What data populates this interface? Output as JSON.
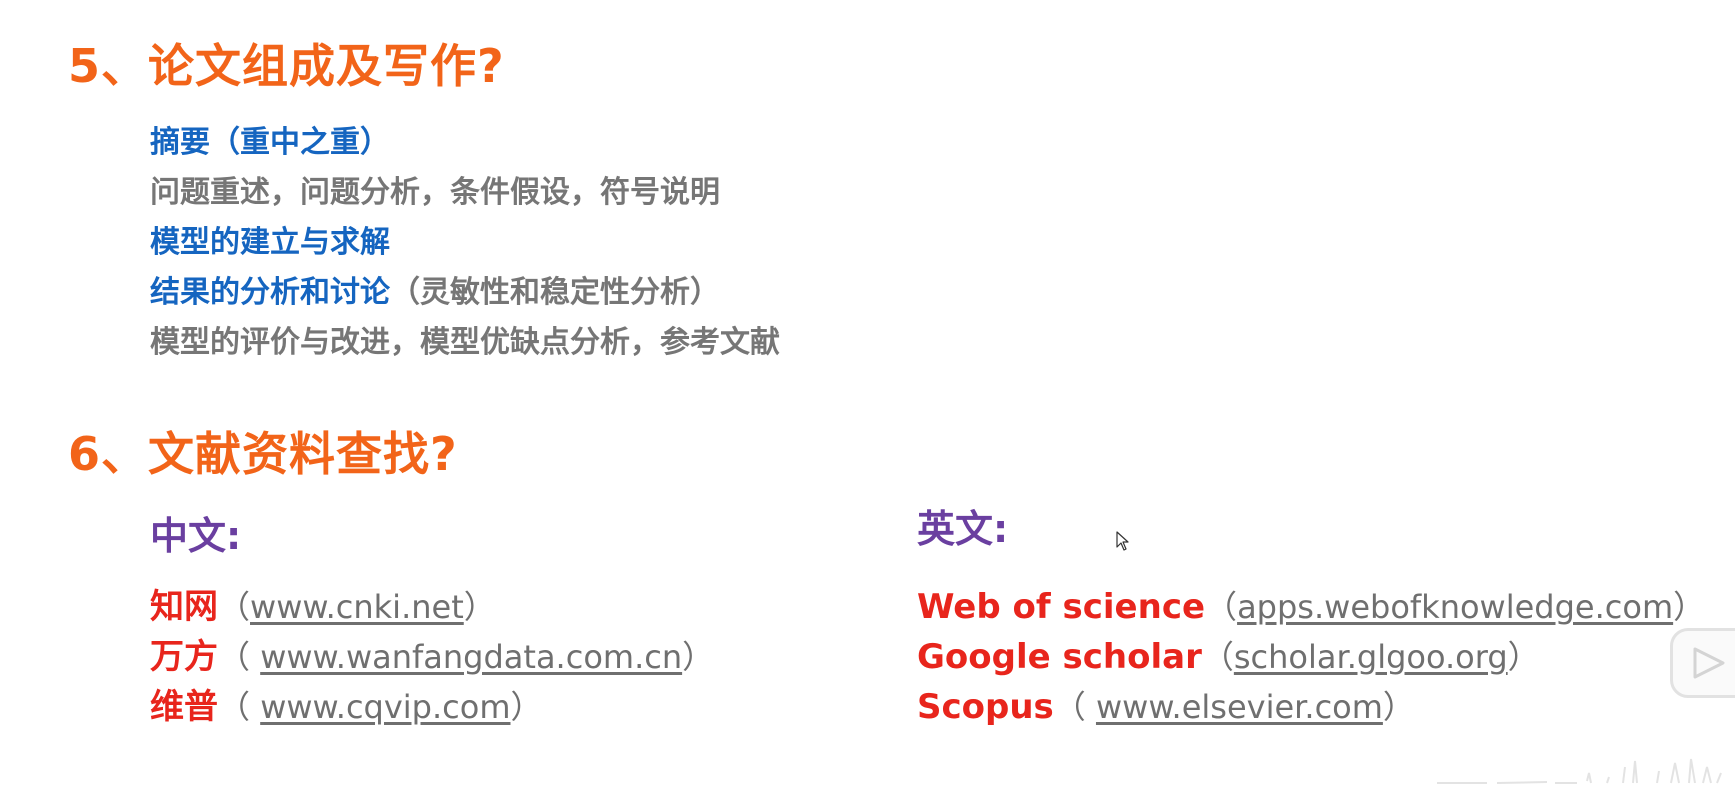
{
  "section5": {
    "title": "5、论文组成及写作?",
    "items": [
      {
        "main": "摘要（重中之重）",
        "extra": ""
      },
      {
        "main": "问题重述，问题分析，条件假设，符号说明",
        "extra": ""
      },
      {
        "main": "模型的建立与求解",
        "extra": ""
      },
      {
        "main": "结果的分析和讨论",
        "extra": "（灵敏性和稳定性分析）"
      },
      {
        "main": "模型的评价与改进，模型优缺点分析，参考文献",
        "extra": ""
      }
    ]
  },
  "section6": {
    "title": "6、文献资料查找?",
    "chinese": {
      "heading": "中文:",
      "links": [
        {
          "name": "知网",
          "open": "（",
          "url": "www.cnki.net",
          "close": "）"
        },
        {
          "name": "万方",
          "open": "（ ",
          "url": "www.wanfangdata.com.cn",
          "close": "）"
        },
        {
          "name": "维普",
          "open": "（ ",
          "url": "www.cqvip.com",
          "close": "）"
        }
      ]
    },
    "english": {
      "heading": "英文:",
      "links": [
        {
          "name": "Web of science",
          "open": "（",
          "url": "apps.webofknowledge.com",
          "close": "）"
        },
        {
          "name": "Google scholar",
          "open": "（",
          "url": "scholar.glgoo.org",
          "close": "）"
        },
        {
          "name": "Scopus",
          "open": "（ ",
          "url": "www.elsevier.com",
          "close": "）"
        }
      ]
    }
  },
  "colors": {
    "heading": "#f26419",
    "blue_text": "#1565c0",
    "gray_text": "#767676",
    "purple_heading": "#6a3fa0",
    "red_name": "#e8251c"
  },
  "icons": {
    "cursor": "mouse-pointer-icon",
    "play": "play-icon"
  }
}
